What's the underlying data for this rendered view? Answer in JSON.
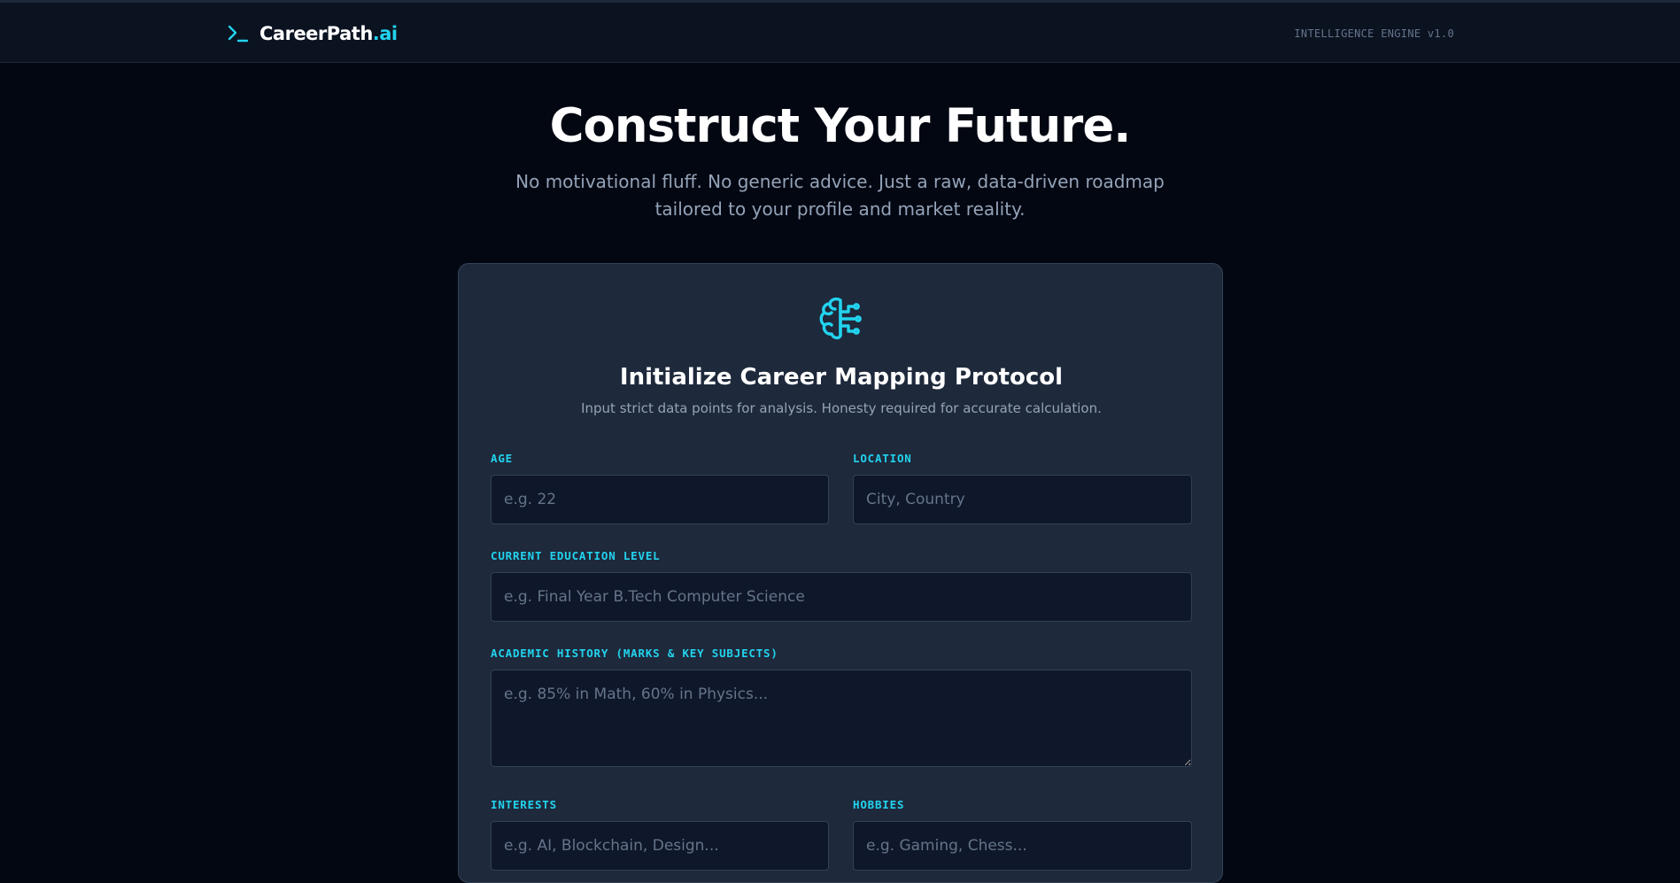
{
  "header": {
    "brand_name": "CareerPath",
    "brand_suffix": ".ai",
    "engine_label": "INTELLIGENCE ENGINE v1.0"
  },
  "hero": {
    "title": "Construct Your Future.",
    "subtitle": "No motivational fluff. No generic advice. Just a raw, data-driven roadmap tailored to your profile and market reality."
  },
  "form": {
    "icon": "brain-circuit-icon",
    "title": "Initialize Career Mapping Protocol",
    "subtitle": "Input strict data points for analysis. Honesty required for accurate calculation.",
    "age": {
      "label": "AGE",
      "placeholder": "e.g. 22"
    },
    "location": {
      "label": "LOCATION",
      "placeholder": "City, Country"
    },
    "education": {
      "label": "CURRENT EDUCATION LEVEL",
      "placeholder": "e.g. Final Year B.Tech Computer Science"
    },
    "academic": {
      "label": "ACADEMIC HISTORY (MARKS & KEY SUBJECTS)",
      "placeholder": "e.g. 85% in Math, 60% in Physics..."
    },
    "interests": {
      "label": "INTERESTS",
      "placeholder": "e.g. AI, Blockchain, Design..."
    },
    "hobbies": {
      "label": "HOBBIES",
      "placeholder": "e.g. Gaming, Chess..."
    }
  },
  "colors": {
    "accent": "#22d3ee",
    "background": "#030712",
    "card": "#1e293b",
    "input": "#0f172a"
  }
}
